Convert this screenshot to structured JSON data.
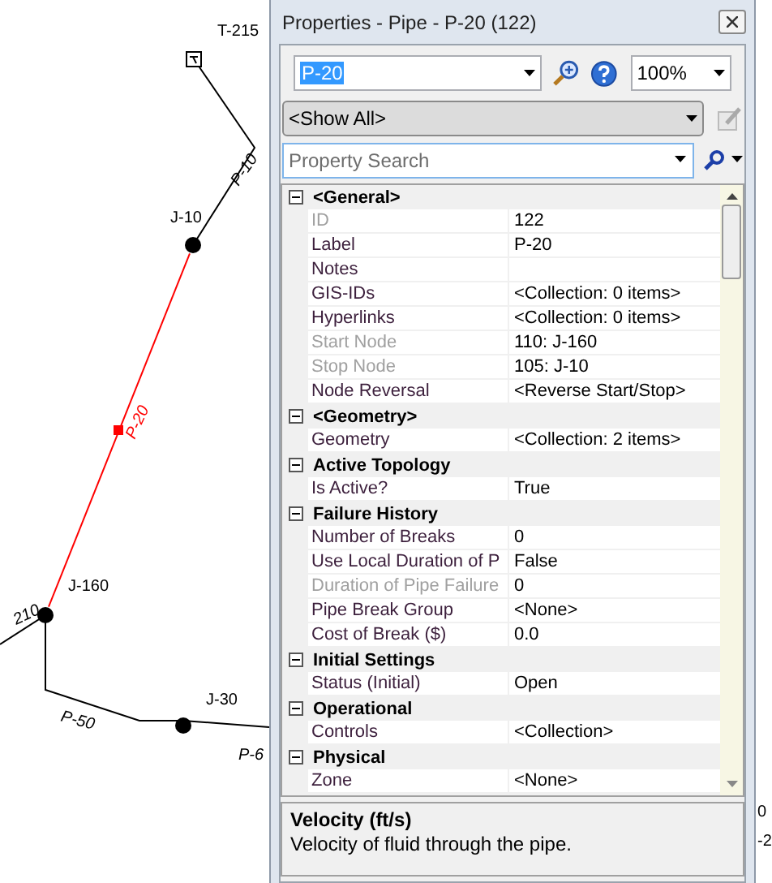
{
  "map": {
    "labels": [
      {
        "text": "T-215",
        "kind": "node"
      },
      {
        "text": "P-10",
        "kind": "pipe"
      },
      {
        "text": "J-10",
        "kind": "node"
      },
      {
        "text": "P-20",
        "kind": "selected-pipe"
      },
      {
        "text": "J-160",
        "kind": "node"
      },
      {
        "text": "210",
        "kind": "pipe"
      },
      {
        "text": "P-50",
        "kind": "pipe"
      },
      {
        "text": "J-30",
        "kind": "node"
      },
      {
        "text": "P-6",
        "kind": "pipe"
      }
    ]
  },
  "panel": {
    "title": "Properties - Pipe - P-20 (122)",
    "element_select": {
      "value": "P-20"
    },
    "zoom_select": {
      "value": "100%"
    },
    "filter_select": {
      "value": "<Show All>"
    },
    "search": {
      "placeholder": "Property Search"
    },
    "rows": [
      {
        "kind": "category",
        "label": "<General>",
        "expanded": true
      },
      {
        "kind": "property",
        "label": "ID",
        "value": "122",
        "disabled": true
      },
      {
        "kind": "property",
        "label": "Label",
        "value": "P-20",
        "disabled": false
      },
      {
        "kind": "property",
        "label": "Notes",
        "disabled": false
      },
      {
        "kind": "property",
        "label": "GIS-IDs",
        "value": "<Collection: 0 items>",
        "disabled": false
      },
      {
        "kind": "property",
        "label": "Hyperlinks",
        "value": "<Collection: 0 items>",
        "disabled": false
      },
      {
        "kind": "property",
        "label": "Start Node",
        "value": "110: J-160",
        "disabled": true
      },
      {
        "kind": "property",
        "label": "Stop Node",
        "value": "105: J-10",
        "disabled": true
      },
      {
        "kind": "property",
        "label": "Node Reversal",
        "value": "<Reverse Start/Stop>",
        "disabled": false
      },
      {
        "kind": "category",
        "label": "<Geometry>",
        "expanded": true
      },
      {
        "kind": "property",
        "label": "Geometry",
        "value": "<Collection: 2 items>",
        "disabled": false
      },
      {
        "kind": "category",
        "label": "Active Topology",
        "expanded": true
      },
      {
        "kind": "property",
        "label": "Is Active?",
        "value": "True",
        "disabled": false
      },
      {
        "kind": "category",
        "label": "Failure History",
        "expanded": true
      },
      {
        "kind": "property",
        "label": "Number of Breaks",
        "value": "0",
        "disabled": false
      },
      {
        "kind": "property",
        "label": "Use Local Duration of P",
        "value": "False",
        "disabled": false
      },
      {
        "kind": "property",
        "label": "Duration of Pipe Failure",
        "value": "0",
        "disabled": true
      },
      {
        "kind": "property",
        "label": "Pipe Break Group",
        "value": "<None>",
        "disabled": false
      },
      {
        "kind": "property",
        "label": "Cost of Break ($)",
        "value": "0.0",
        "disabled": false
      },
      {
        "kind": "category",
        "label": "Initial Settings",
        "expanded": true
      },
      {
        "kind": "property",
        "label": "Status (Initial)",
        "value": "Open",
        "disabled": false
      },
      {
        "kind": "category",
        "label": "Operational",
        "expanded": true
      },
      {
        "kind": "property",
        "label": "Controls",
        "value": "<Collection>",
        "disabled": false
      },
      {
        "kind": "category",
        "label": "Physical",
        "expanded": true
      },
      {
        "kind": "property",
        "label": "Zone",
        "value": "<None>",
        "disabled": false
      }
    ],
    "description": {
      "title": "Velocity (ft/s)",
      "text": "Velocity of fluid through the pipe."
    }
  },
  "edge_texts": [
    "0",
    "-2"
  ]
}
